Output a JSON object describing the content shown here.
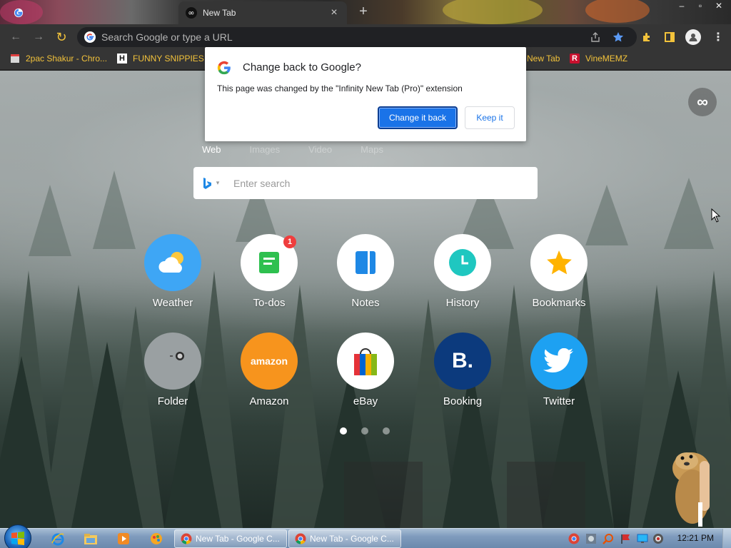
{
  "browser": {
    "tabs": [
      {
        "title": "",
        "active": false
      },
      {
        "title": "New Tab",
        "active": true,
        "close_glyph": "×"
      }
    ],
    "new_tab_glyph": "+",
    "window_controls": [
      "–",
      "▫",
      "✕"
    ],
    "omnibox": {
      "placeholder": "Search Google or type a URL"
    },
    "nav": {
      "back": "←",
      "forward": "→",
      "reload": "↻"
    }
  },
  "bookmarks": [
    {
      "label": "2pac Shakur - Chro...",
      "icon": "bookmark-app-icon"
    },
    {
      "label": "FUNNY SNIPPIES",
      "icon": "h-letter-icon"
    },
    {
      "label": "New Tab",
      "icon": "infinity-icon"
    },
    {
      "label": "VineMEMZ",
      "icon": "r-letter-icon"
    }
  ],
  "popup": {
    "title": "Change back to Google?",
    "description": "This page was changed by the \"Infinity New Tab (Pro)\" extension",
    "primary_button": "Change it back",
    "secondary_button": "Keep it"
  },
  "infinity_button": "∞",
  "search": {
    "tabs": [
      "Web",
      "Images",
      "Video",
      "Maps"
    ],
    "active_tab": "Web",
    "placeholder": "Enter search",
    "engine_caret": "▾"
  },
  "apps": [
    {
      "label": "Weather",
      "icon": "weather-icon",
      "color": "#3ea6f5"
    },
    {
      "label": "To-dos",
      "icon": "todo-icon",
      "color": "#ffffff",
      "badge": "1"
    },
    {
      "label": "Notes",
      "icon": "notes-icon",
      "color": "#ffffff"
    },
    {
      "label": "History",
      "icon": "history-icon",
      "color": "#ffffff"
    },
    {
      "label": "Bookmarks",
      "icon": "star-icon",
      "color": "#ffffff"
    },
    {
      "label": "Folder",
      "icon": "folder-icon",
      "color": "#9aa0a2"
    },
    {
      "label": "Amazon",
      "icon": "amazon-icon",
      "color": "#f7941d",
      "logo_text": "amazon"
    },
    {
      "label": "eBay",
      "icon": "ebay-icon",
      "color": "#ffffff"
    },
    {
      "label": "Booking",
      "icon": "booking-icon",
      "color": "#0c3a7d",
      "logo_text": "B."
    },
    {
      "label": "Twitter",
      "icon": "twitter-icon",
      "color": "#1da1f2"
    }
  ],
  "pagination": {
    "pages": 3,
    "current": 1
  },
  "taskbar": {
    "tasks": [
      {
        "label": "New Tab - Google C...",
        "icon": "chrome-icon"
      },
      {
        "label": "New Tab - Google C...",
        "icon": "chrome-icon"
      }
    ],
    "pinned": [
      "ie-icon",
      "explorer-icon",
      "media-player-icon",
      "paint-icon"
    ],
    "clock": "12:21 PM"
  }
}
